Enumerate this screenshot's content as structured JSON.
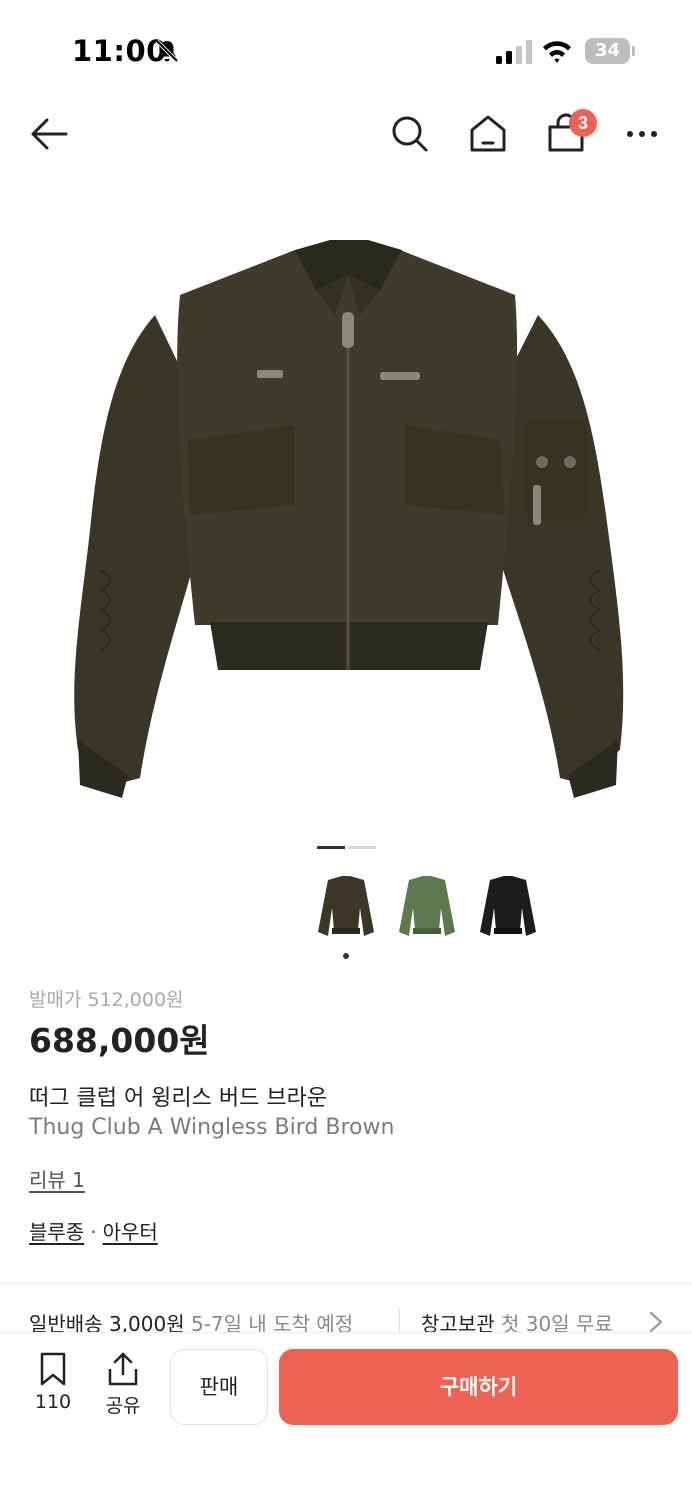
{
  "status_bar": {
    "time": "11:00",
    "battery": "34"
  },
  "header": {
    "cart_count": "3"
  },
  "product": {
    "release_price_label": "발매가 512,000원",
    "price": "688,000원",
    "name_ko": "떠그 클럽 어 윙리스 버드 브라운",
    "name_en": "Thug Club A Wingless Bird Brown",
    "review_link": "리뷰 1",
    "categories": [
      "블루종",
      "아우터"
    ],
    "category_separator": "·",
    "image_pager": {
      "total": 2,
      "active_index": 0
    },
    "color_options": [
      {
        "name": "brown",
        "color": "#3b3626"
      },
      {
        "name": "green",
        "color": "#5c7a4e"
      },
      {
        "name": "black",
        "color": "#1c1c1c"
      }
    ],
    "selected_color_index": 0
  },
  "delivery": {
    "standard_label": "일반배송 3,000원",
    "standard_eta": "5-7일 내 도착 예정",
    "storage_label": "창고보관",
    "storage_free": "첫 30일 무료"
  },
  "bottom_bar": {
    "save_count": "110",
    "share_label": "공유",
    "sell_label": "판매",
    "buy_label": "구매하기",
    "accent_color": "#ef6253"
  }
}
